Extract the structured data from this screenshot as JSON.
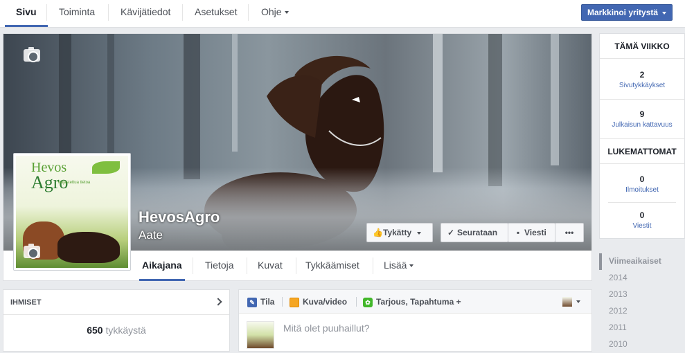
{
  "topbar": {
    "tabs": [
      "Sivu",
      "Toiminta",
      "Kävijätiedot",
      "Asetukset",
      "Ohje"
    ],
    "promote_label": "Markkinoi yritystä"
  },
  "page": {
    "name": "HevosAgro",
    "category": "Aate",
    "logo_line1": "Hevos",
    "logo_line2": "Agro",
    "logo_tagline": "Valjastettua tietoa",
    "buttons": {
      "liked": "Tykätty",
      "following": "Seurataan",
      "message": "Viesti",
      "more": "•••"
    },
    "tabs": [
      "Aikajana",
      "Tietoja",
      "Kuvat",
      "Tykkäämiset",
      "Lisää"
    ]
  },
  "stats": {
    "this_week": "TÄMÄ VIIKKO",
    "page_likes_value": "2",
    "page_likes_label": "Sivutykkäykset",
    "post_reach_value": "9",
    "post_reach_label": "Julkaisun kattavuus",
    "unread": "LUKEMATTOMAT",
    "notifications_value": "0",
    "notifications_label": "Ilmoitukset",
    "messages_value": "0",
    "messages_label": "Viestit"
  },
  "years": [
    "Viimeaikaiset",
    "2014",
    "2013",
    "2012",
    "2011",
    "2010"
  ],
  "people": {
    "header": "IHMISET",
    "likes_count": "650",
    "likes_label": "tykkäystä"
  },
  "composer": {
    "tab_status": "Tila",
    "tab_photo": "Kuva/video",
    "tab_offer": "Tarjous, Tapahtuma +",
    "placeholder": "Mitä olet puuhaillut?"
  },
  "colors": {
    "accent": "#4267b2",
    "background": "#e9ebee"
  }
}
